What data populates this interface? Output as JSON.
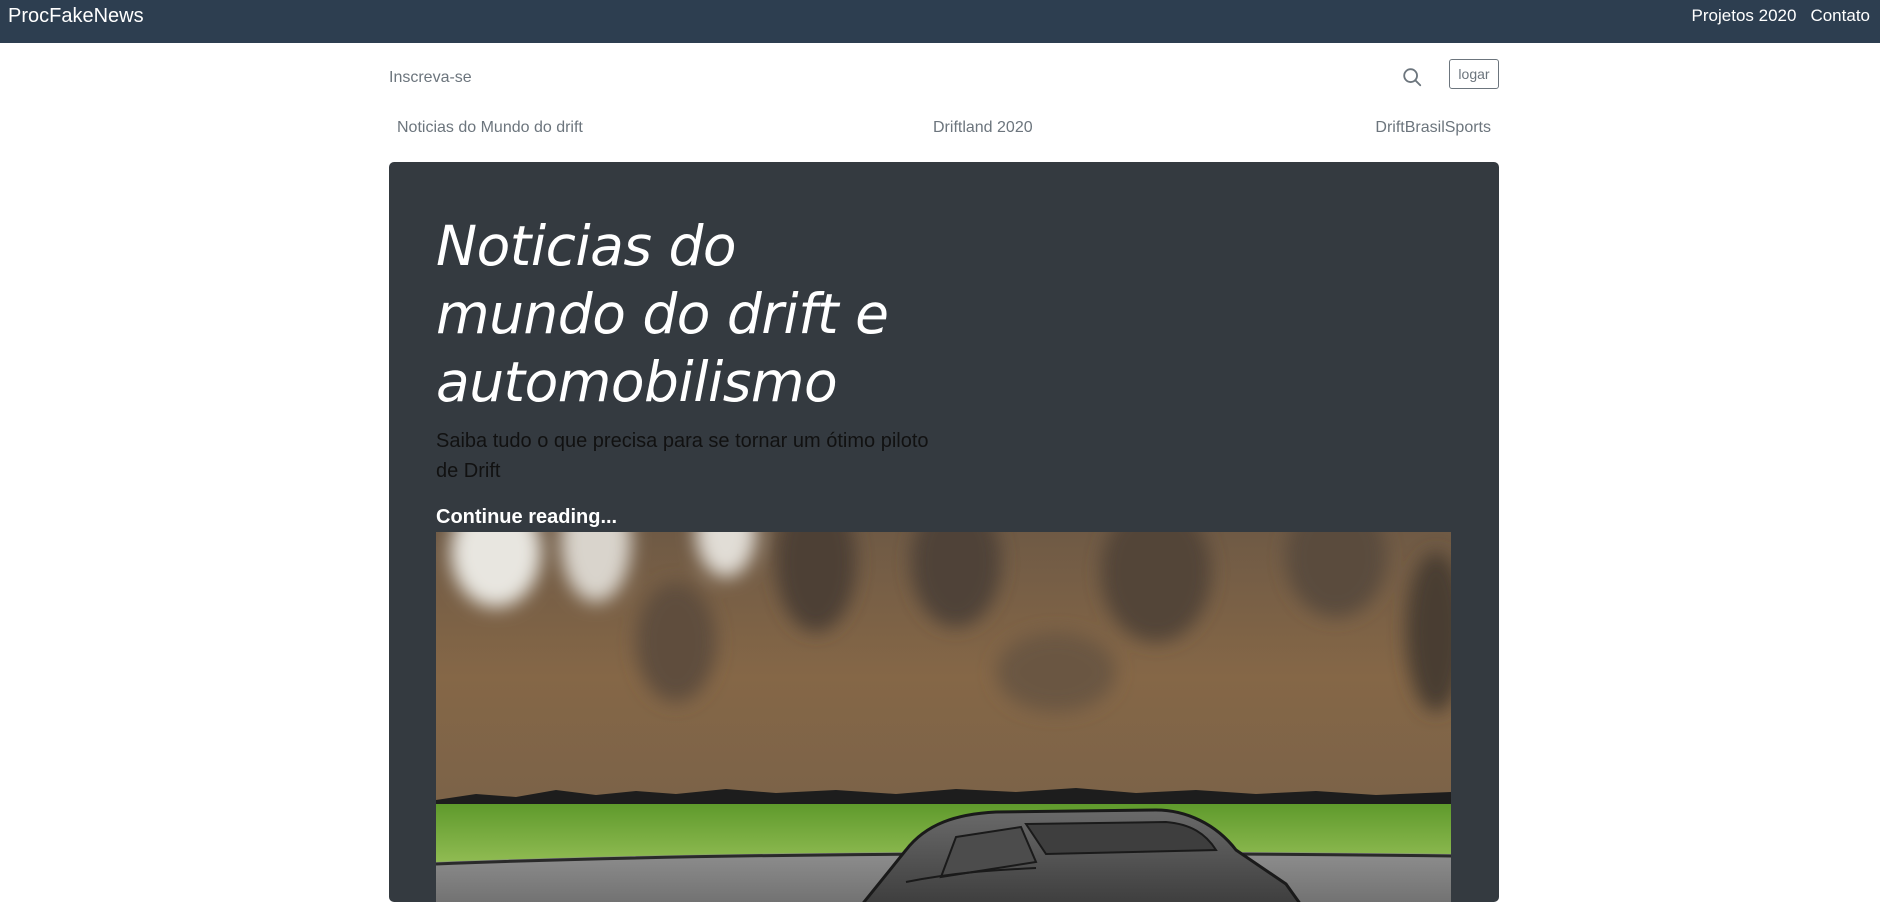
{
  "navbar": {
    "brand": "ProcFakeNews",
    "links": [
      "Projetos 2020",
      "Contato"
    ],
    "background": "#2d3e50"
  },
  "blog_header": {
    "subscribe_label": "Inscreva-se",
    "search_icon": "search-icon",
    "login_label": "logar"
  },
  "categories": [
    "Noticias do Mundo do drift",
    "Driftland 2020",
    "DriftBrasilSports"
  ],
  "jumbotron": {
    "title": "Noticias do mundo do drift e automobilismo",
    "lead": "Saiba tudo o que precisa para se tornar um ótimo piloto de Drift",
    "continue_label": "Continue reading...",
    "background": "#343a40",
    "image": "drift-car-illustration"
  }
}
